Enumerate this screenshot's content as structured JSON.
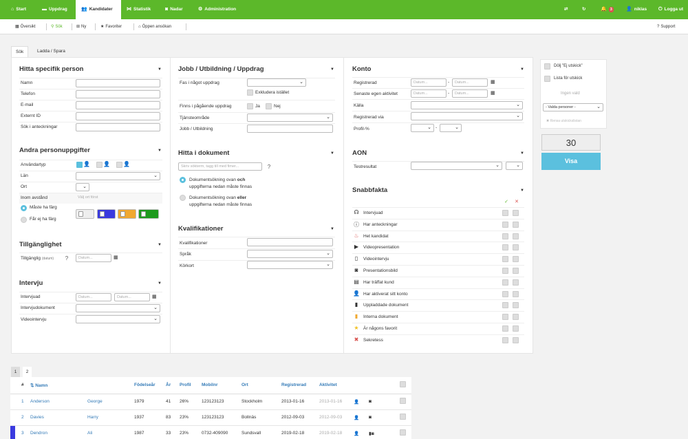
{
  "topnav": {
    "items": [
      {
        "label": "Start",
        "icon": "home-icon"
      },
      {
        "label": "Uppdrag",
        "icon": "folder-icon"
      },
      {
        "label": "Kandidater",
        "icon": "users-icon"
      },
      {
        "label": "Statistik",
        "icon": "chart-icon"
      },
      {
        "label": "Nadar",
        "icon": "camera-icon"
      },
      {
        "label": "Administration",
        "icon": "gear-icon"
      }
    ],
    "right": {
      "notif_count": "3",
      "user": "niklas",
      "logout": "Logga ut"
    },
    "brand_color": "#5cb82a"
  },
  "subbar": {
    "items": [
      "Översikt",
      "Sök",
      "Ny",
      "Favoriter",
      "Öppen ansökan"
    ],
    "support": "Support"
  },
  "tabs": [
    "Sök",
    "Ladda / Spara"
  ],
  "col1": {
    "section1": {
      "title": "Hitta specifik person",
      "fields": [
        "Namn",
        "Telefon",
        "E-mail",
        "Externt ID",
        "Sök i anteckningar"
      ]
    },
    "section2": {
      "title": "Andra personuppgifter",
      "fields": [
        "Användartyp",
        "Län",
        "Ort",
        "Inom avstånd"
      ],
      "avstand_placeholder": "Välj ort först",
      "radio1": "Måste ha färg",
      "radio2": "Får ej ha färg"
    },
    "section3": {
      "title": "Tillgänglighet",
      "label": "Tillgänglig",
      "label_small": "(datum)",
      "placeholder": "Datum..."
    },
    "section4": {
      "title": "Intervju",
      "fields": [
        "Intervjuad",
        "Intervjudokument",
        "Videointervju"
      ],
      "placeholder": "Datum..."
    }
  },
  "col2": {
    "section1": {
      "title": "Jobb / Utbildning / Uppdrag",
      "f1": "Fas i något uppdrag",
      "exclude": "Exkludera istället",
      "f2": "Finns i pågående uppdrag",
      "ja": "Ja",
      "nej": "Nej",
      "f3": "Tjänsteområde",
      "f4": "Jobb / Utbildning"
    },
    "section2": {
      "title": "Hitta i dokument",
      "placeholder": "Skriv sökterm, tagg till med fimer...",
      "r1a": "Dokumentsökning ovan",
      "r1b": "och",
      "r1c": "uppgifterna nedan måste finnas",
      "r2a": "Dokumentsökning ovan",
      "r2b": "eller",
      "r2c": "uppgifterna nedan måste finnas"
    },
    "section3": {
      "title": "Kvalifikationer",
      "fields": [
        "Kvalifikationer",
        "Språk",
        "Körkort"
      ]
    }
  },
  "col3": {
    "konto": {
      "title": "Konto",
      "fields": [
        "Registrerad",
        "Senaste egen aktivitet",
        "Källa",
        "Registrerad via",
        "Profil-%"
      ],
      "placeholder": "Datum..."
    },
    "aon": {
      "title": "AON",
      "field": "Testresultat"
    },
    "snabb": {
      "title": "Snabbfakta",
      "items": [
        {
          "label": "Intervjuad",
          "icon": "headset-icon"
        },
        {
          "label": "Har anteckningar",
          "icon": "info-icon"
        },
        {
          "label": "Het kandidat",
          "icon": "fire-icon"
        },
        {
          "label": "Videopresentation",
          "icon": "video-icon"
        },
        {
          "label": "Videointervju",
          "icon": "phone-icon"
        },
        {
          "label": "Presentationsbild",
          "icon": "camera-icon"
        },
        {
          "label": "Har träffat kund",
          "icon": "briefcase-icon"
        },
        {
          "label": "Har aktiverat sitt konto",
          "icon": "user-icon"
        },
        {
          "label": "Uppladdade dokument",
          "icon": "document-icon"
        },
        {
          "label": "Interna dokument",
          "icon": "folder-icon"
        },
        {
          "label": "Är någons favorit",
          "icon": "star-icon"
        },
        {
          "label": "Sekretess",
          "icon": "cross-icon"
        }
      ]
    }
  },
  "side": {
    "opt1": "Dölj \"Ej utskick\"",
    "opt2": "Lista för utskick",
    "none_selected": "Ingen vald",
    "select": "- Valda personer -",
    "clear": "✖ Rensa utskickslistan",
    "count": "30",
    "visa": "Visa"
  },
  "results": {
    "pages": [
      "1",
      "2"
    ],
    "headers": [
      "#",
      "Namn",
      "Födelseår",
      "År",
      "Profil",
      "Mobilnr",
      "Ort",
      "Registrerad",
      "Aktivitet"
    ],
    "rows": [
      {
        "n": "1",
        "last": "Anderson",
        "first": "George",
        "year": "1979",
        "age": "41",
        "profile": "26%",
        "mobile": "123123123",
        "city": "Stockholm",
        "reg": "2013-01-16",
        "act": "2013-01-16",
        "bar": "#ffffff"
      },
      {
        "n": "2",
        "last": "Davies",
        "first": "Harry",
        "year": "1937",
        "age": "83",
        "profile": "23%",
        "mobile": "123123123",
        "city": "Bollnäs",
        "reg": "2012-09-03",
        "act": "2012-09-03",
        "bar": "#ffffff"
      },
      {
        "n": "3",
        "last": "Dendron",
        "first": "Ali",
        "year": "1987",
        "age": "33",
        "profile": "23%",
        "mobile": "0732-409090",
        "city": "Sundsvall",
        "reg": "2019-02-18",
        "act": "2019-02-18",
        "bar": "#3a3adf"
      }
    ]
  }
}
